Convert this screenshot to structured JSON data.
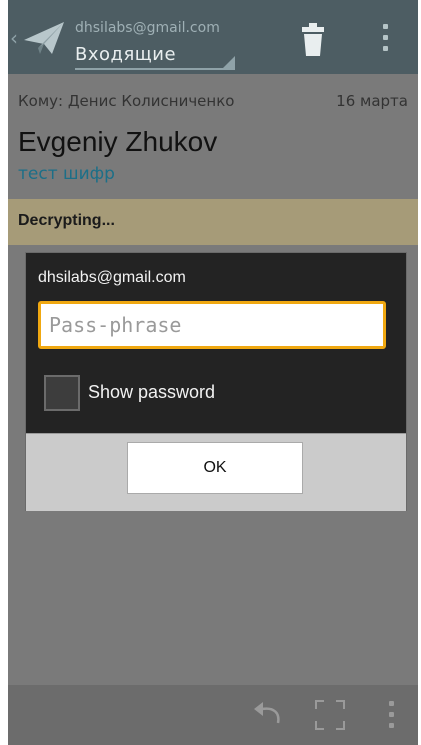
{
  "header": {
    "account": "dhsilabs@gmail.com",
    "folder": "Входящие"
  },
  "message": {
    "to": "Кому: Денис Колисниченко",
    "date": "16 марта",
    "sender": "Evgeniy Zhukov",
    "subject": "тест шифр"
  },
  "status": {
    "decrypting": "Decrypting..."
  },
  "dialog": {
    "account": "dhsilabs@gmail.com",
    "passphrase_value": "",
    "passphrase_placeholder": "Pass-phrase",
    "show_password_label": "Show password",
    "show_password_checked": false,
    "ok_label": "OK"
  },
  "icons": {
    "app": "paper-plane-icon",
    "trash": "trash-icon",
    "overflow": "overflow-menu-icon",
    "undo": "undo-icon",
    "fullscreen": "fullscreen-icon"
  },
  "colors": {
    "action_bar": "#4d5d63",
    "decrypt_bar": "#a69b78",
    "input_focus": "#f0a811",
    "subject_link": "#1c6f88"
  }
}
